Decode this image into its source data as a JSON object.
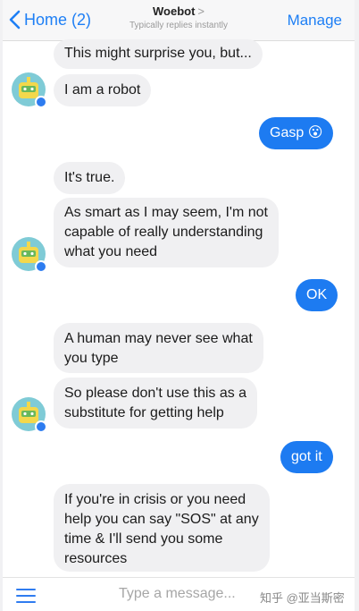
{
  "header": {
    "back_label": "Home (2)",
    "title": "Woebot",
    "title_caret": ">",
    "subtitle": "Typically replies instantly",
    "manage_label": "Manage"
  },
  "messages": [
    {
      "from": "bot",
      "text": "This might surprise you, but..."
    },
    {
      "from": "bot",
      "text": "I am a robot"
    },
    {
      "from": "user",
      "text": "Gasp 😮"
    },
    {
      "from": "bot",
      "text": "It's true."
    },
    {
      "from": "bot",
      "text": "As smart as I may seem, I'm not\ncapable of really understanding\nwhat you need"
    },
    {
      "from": "user",
      "text": "OK"
    },
    {
      "from": "bot",
      "text": "A human may never see what\nyou type"
    },
    {
      "from": "bot",
      "text": "So please don't use this as a\nsubstitute for getting help"
    },
    {
      "from": "user",
      "text": "got it"
    },
    {
      "from": "bot",
      "text": "If you're in crisis or you need\nhelp you can say \"SOS\" at any\ntime & I'll send you some\nresources"
    }
  ],
  "composer": {
    "placeholder": "Type a message...",
    "menu_icon": "hamburger-menu-icon"
  },
  "watermark": "知乎 @亚当斯密",
  "colors": {
    "accent": "#1e7ff5",
    "user_bubble": "#1d7bf1",
    "bot_bubble": "#f0f0f2"
  }
}
